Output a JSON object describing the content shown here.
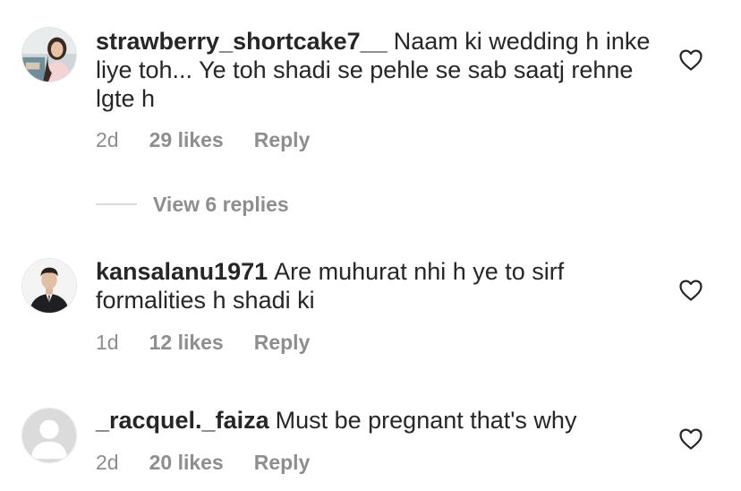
{
  "comments": [
    {
      "username": "strawberry_shortcake7__",
      "text": "Naam ki wedding h inke liye toh... Ye toh shadi se pehle se sab saatj rehne lgte h",
      "age": "2d",
      "likes": "29 likes",
      "reply_label": "Reply",
      "avatar_icon": "profile-photo-girl",
      "view_replies_label": "View 6 replies"
    },
    {
      "username": "kansalanu1971",
      "text": "Are muhurat nhi h ye to sirf formalities h shadi ki",
      "age": "1d",
      "likes": "12 likes",
      "reply_label": "Reply",
      "avatar_icon": "profile-photo-man-suit"
    },
    {
      "username": "_racquel._faiza",
      "text": "Must be pregnant that's why",
      "age": "2d",
      "likes": "20 likes",
      "reply_label": "Reply",
      "avatar_icon": "default-avatar"
    }
  ],
  "colors": {
    "text": "#262626",
    "secondary": "#8e8e8e",
    "divider": "#dbdbdb"
  },
  "icons": {
    "like": "heart-outline-icon"
  }
}
